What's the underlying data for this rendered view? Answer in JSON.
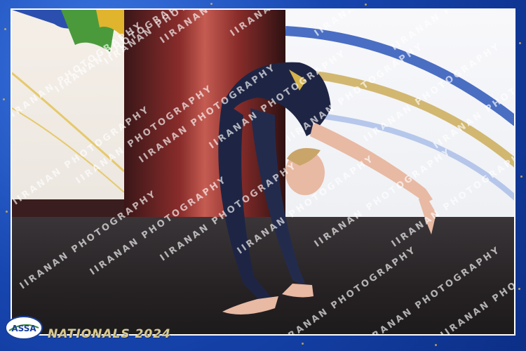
{
  "photo": {
    "description_id": "dancer-backbend",
    "colors": {
      "frame_blue": "#1a4fb8",
      "gold": "#d9c98a",
      "leotard": "#1e2544",
      "skin": "#e8b9a3"
    }
  },
  "watermark": {
    "text": "IIRANAN PHOTOGRAPHY"
  },
  "branding": {
    "logo_text": "ASSA",
    "event_title": "NATIONALS 2024"
  }
}
